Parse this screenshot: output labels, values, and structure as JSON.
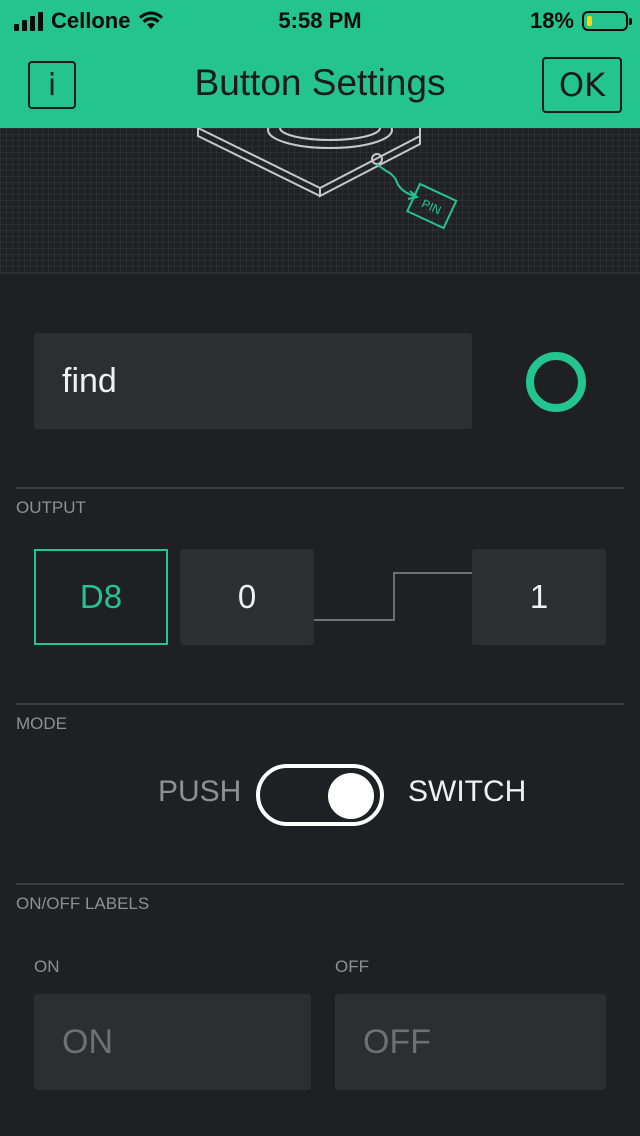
{
  "status": {
    "carrier": "Cellone",
    "time": "5:58 PM",
    "battery": "18%",
    "battery_level": 0.18
  },
  "header": {
    "info_label": "i",
    "title": "Button Settings",
    "ok_label": "OK"
  },
  "illustration": {
    "pin_tag": "PIN"
  },
  "widget": {
    "name_value": "find",
    "color": "#23c48e"
  },
  "output": {
    "section_label": "OUTPUT",
    "pin": "D8",
    "low_value": "0",
    "high_value": "1"
  },
  "mode": {
    "section_label": "MODE",
    "push_label": "PUSH",
    "switch_label": "SWITCH",
    "selected": "SWITCH"
  },
  "labels": {
    "section_label": "ON/OFF LABELS",
    "on_caption": "ON",
    "off_caption": "OFF",
    "on_placeholder": "ON",
    "off_placeholder": "OFF"
  },
  "colors": {
    "accent": "#23c48e",
    "background": "#1f2024",
    "field": "#2d2e32"
  }
}
